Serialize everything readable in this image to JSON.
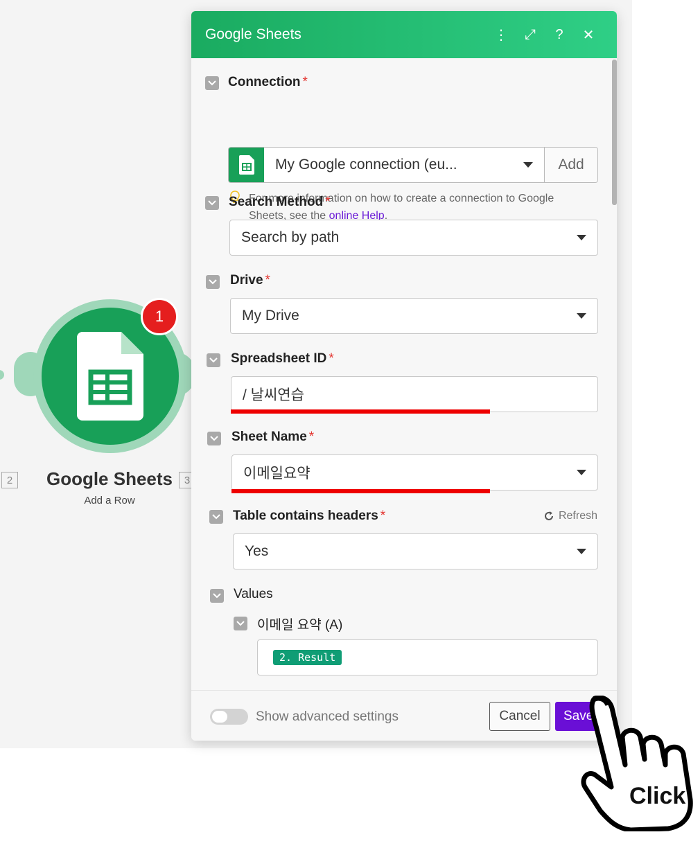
{
  "node": {
    "title": "Google Sheets",
    "subtitle": "Add a Row",
    "badge": "1",
    "left_index": "2",
    "right_index": "3"
  },
  "dialog": {
    "title": "Google Sheets",
    "header_icons": [
      "more-vertical-icon",
      "expand-icon",
      "help-icon",
      "close-icon"
    ],
    "header_glyphs": {
      "more": "⋮",
      "expand": "⤢",
      "help": "?",
      "close": "✕"
    }
  },
  "connection": {
    "label": "Connection",
    "required": "*",
    "value": "My Google connection (eu...",
    "add_label": "Add",
    "hint_text": "For more information on how to create a connection to Google Sheets, see the",
    "hint_link": "online Help",
    "hint_end": "."
  },
  "search_method": {
    "label": "Search Method",
    "required": "*",
    "value": "Search by path"
  },
  "drive": {
    "label": "Drive",
    "required": "*",
    "value": "My Drive"
  },
  "spreadsheet_id": {
    "label": "Spreadsheet ID",
    "required": "*",
    "value": "/ 날씨연습"
  },
  "sheet_name": {
    "label": "Sheet Name",
    "required": "*",
    "value": "이메일요약"
  },
  "table_headers": {
    "label": "Table contains headers",
    "required": "*",
    "refresh_label": "Refresh",
    "value": "Yes"
  },
  "values": {
    "label": "Values",
    "column_label": "이메일 요약 (A)",
    "mapped_value": "2. Result"
  },
  "footer": {
    "advanced_label": "Show advanced settings",
    "cancel_label": "Cancel",
    "save_label": "Save"
  },
  "overlay": {
    "click_label": "Click"
  },
  "colors": {
    "header_green": "#1aab60",
    "save_purple": "#6a0fd6",
    "link_purple": "#6a1bd6",
    "required_red": "#e3342f",
    "annotation_red": "#ee0000",
    "pill_teal": "#0f9d75"
  }
}
